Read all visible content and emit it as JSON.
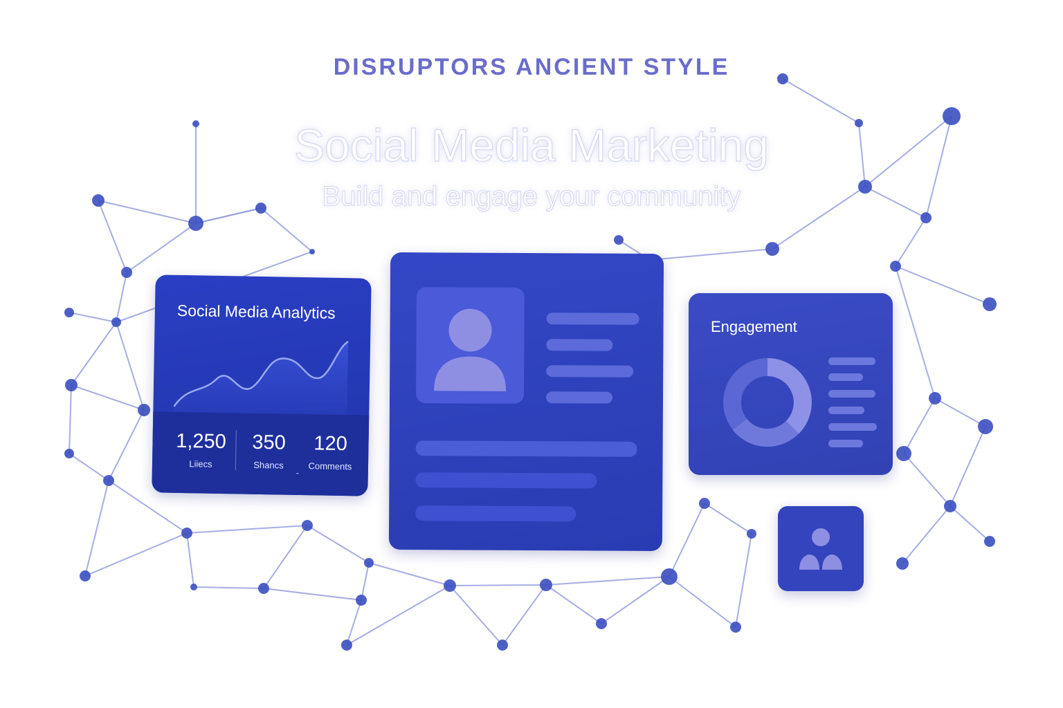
{
  "header": {
    "brand": "DISRUPTORS ANCIENT STYLE",
    "title": "Social Media Marketing",
    "subtitle": "Build and engage your community"
  },
  "analytics_card": {
    "title": "Social Media Analytics",
    "stats": [
      {
        "value": "1,250",
        "label": "Liiecs"
      },
      {
        "value": "350",
        "label": "Shancs"
      },
      {
        "value": "120",
        "label": "Comments"
      }
    ],
    "dash": "-"
  },
  "engagement_card": {
    "title": "Engagement"
  },
  "colors": {
    "accent": "#6a6ccc",
    "card_blue": "#2f3fc0",
    "network_node": "#3b4fc0",
    "network_line": "#8e99dc"
  },
  "icons": [
    "person-icon",
    "donut-chart-icon",
    "community-icon",
    "line-chart-icon"
  ]
}
